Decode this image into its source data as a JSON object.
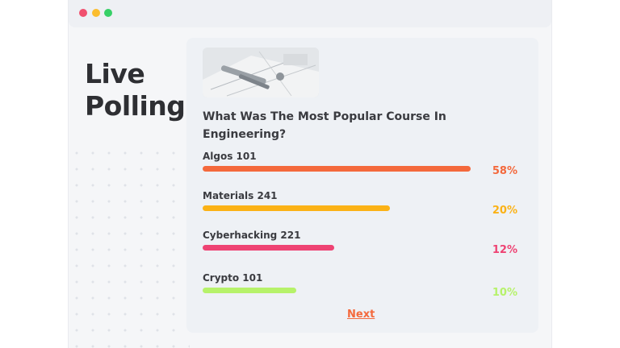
{
  "window": {
    "controls": [
      {
        "name": "close",
        "color": "#f0506e"
      },
      {
        "name": "minimize",
        "color": "#fbbd2e"
      },
      {
        "name": "zoom",
        "color": "#37d067"
      }
    ]
  },
  "sidebar": {
    "title_line1": "Live",
    "title_line2": "Polling"
  },
  "poll": {
    "question": "What Was The Most Popular Course In Engineering?",
    "options": [
      {
        "label": "Algos 101",
        "percent_text": "58%",
        "fill_fraction": 1.0,
        "color": "#f4693c"
      },
      {
        "label": "Materials 241",
        "percent_text": "20%",
        "fill_fraction": 0.7,
        "color": "#fbb216"
      },
      {
        "label": "Cyberhacking 221",
        "percent_text": "12%",
        "fill_fraction": 0.49,
        "color": "#ee4373"
      },
      {
        "label": "Crypto 101",
        "percent_text": "10%",
        "fill_fraction": 0.35,
        "color": "#b6f26a"
      }
    ],
    "next_label": "Next",
    "next_color": "#f4693c"
  }
}
